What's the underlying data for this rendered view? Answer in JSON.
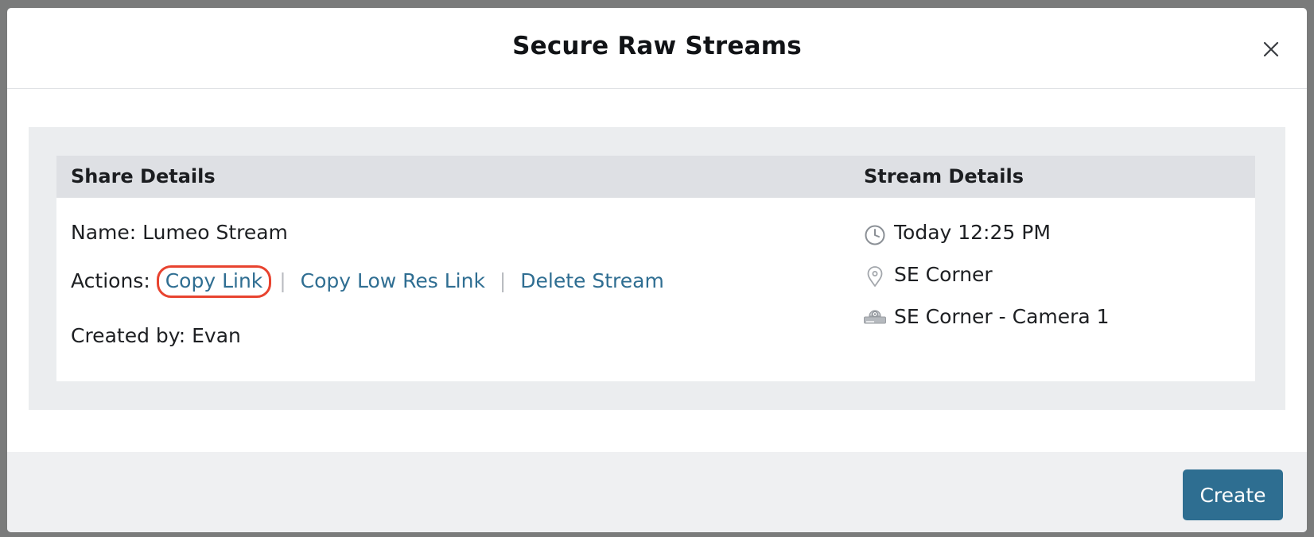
{
  "modal": {
    "title": "Secure Raw Streams",
    "close_icon": "close-icon"
  },
  "share_details": {
    "header": "Share Details",
    "name_label": "Name:",
    "name_value": "Lumeo Stream",
    "actions_label": "Actions:",
    "actions": {
      "copy_link": "Copy Link",
      "copy_low_res_link": "Copy Low Res Link",
      "delete_stream": "Delete Stream",
      "separator": "|"
    },
    "created_by_label": "Created by:",
    "created_by_value": "Evan"
  },
  "stream_details": {
    "header": "Stream Details",
    "items": [
      {
        "icon": "clock-icon",
        "text": "Today 12:25 PM"
      },
      {
        "icon": "location-pin-icon",
        "text": "SE Corner"
      },
      {
        "icon": "camera-icon",
        "text": "SE Corner - Camera 1"
      }
    ]
  },
  "footer": {
    "create_label": "Create"
  },
  "colors": {
    "link": "#2f6e92",
    "highlight_ring": "#e8432f",
    "primary_button": "#2e6e91",
    "panel_header": "#dee0e4",
    "panel_background": "#ebedef"
  }
}
